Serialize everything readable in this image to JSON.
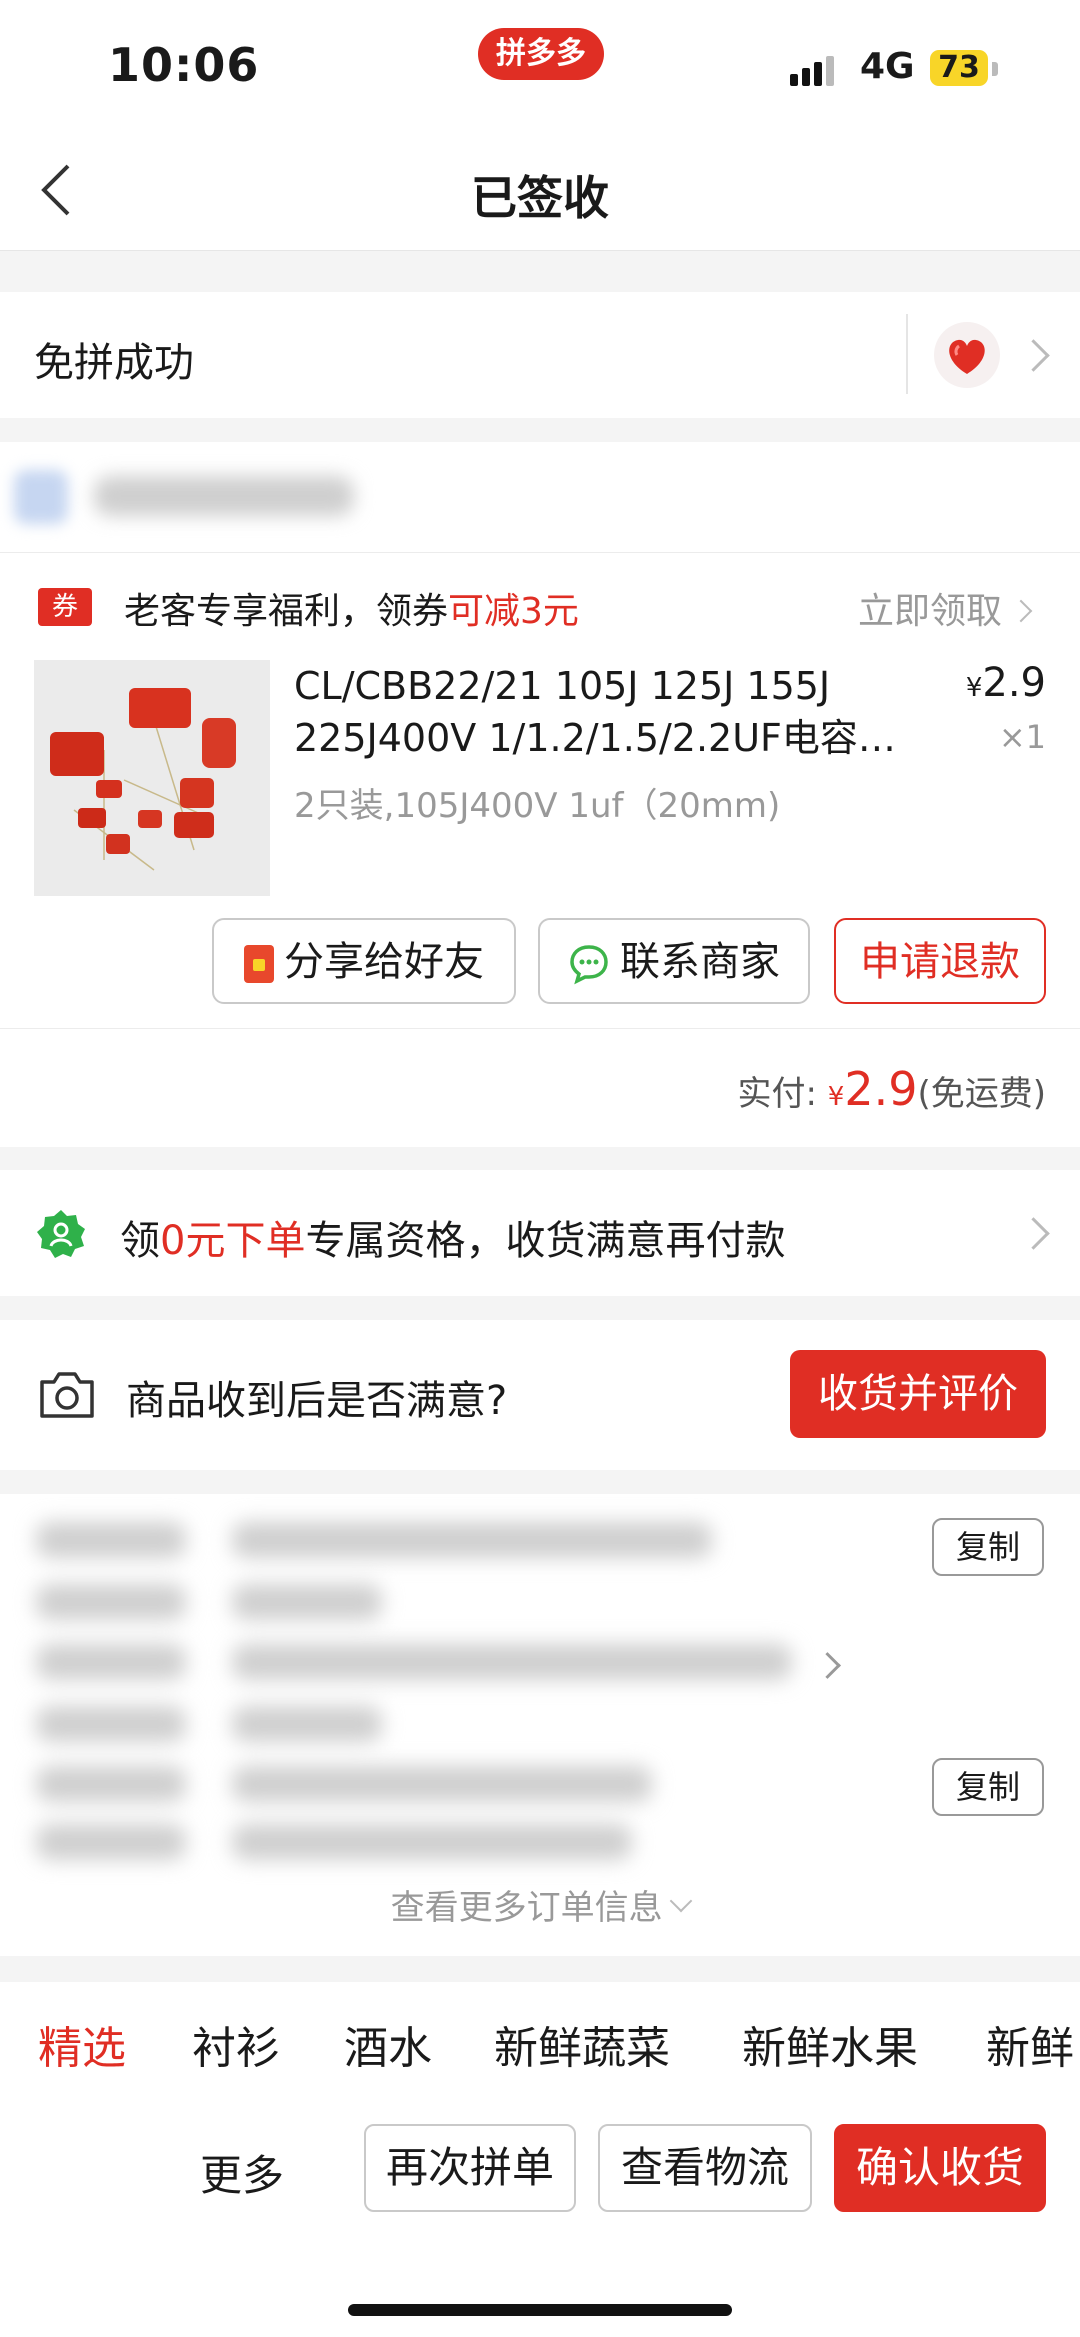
{
  "status_bar": {
    "time": "10:06",
    "app_badge": "拼多多",
    "network": "4G",
    "battery": "73"
  },
  "nav": {
    "title": "已签收"
  },
  "group": {
    "label": "免拼成功"
  },
  "coupon": {
    "tag": "券",
    "text_prefix": "老客专享福利，领券",
    "text_highlight": "可减3元",
    "claim": "立即领取"
  },
  "product": {
    "title": "CL/CBB22/21 105J 125J 155J 225J400V 1/1.2/1.5/2.2UF电容…",
    "price_symbol": "¥",
    "price": "2.9",
    "quantity": "×1",
    "spec": "2只装,105J400V 1uf（20mm)"
  },
  "order_actions": {
    "share": "分享给好友",
    "contact": "联系商家",
    "refund": "申请退款"
  },
  "payment": {
    "label": "实付:",
    "symbol": "¥",
    "amount": "2.9",
    "note": "(免运费)"
  },
  "promo": {
    "prefix": "领",
    "highlight": "0元下单",
    "suffix": "专属资格，收货满意再付款"
  },
  "review": {
    "question": "商品收到后是否满意?",
    "button": "收货并评价"
  },
  "order_info": {
    "copy_label": "复制",
    "more": "查看更多订单信息"
  },
  "category_tabs": [
    "精选",
    "衬衫",
    "酒水",
    "新鲜蔬菜",
    "新鲜水果",
    "新鲜"
  ],
  "bottom_bar": {
    "more": "更多",
    "regroup": "再次拼单",
    "logistics": "查看物流",
    "confirm": "确认收货"
  },
  "colors": {
    "brand_red": "#e02e24",
    "badge_yellow": "#f8d528"
  }
}
